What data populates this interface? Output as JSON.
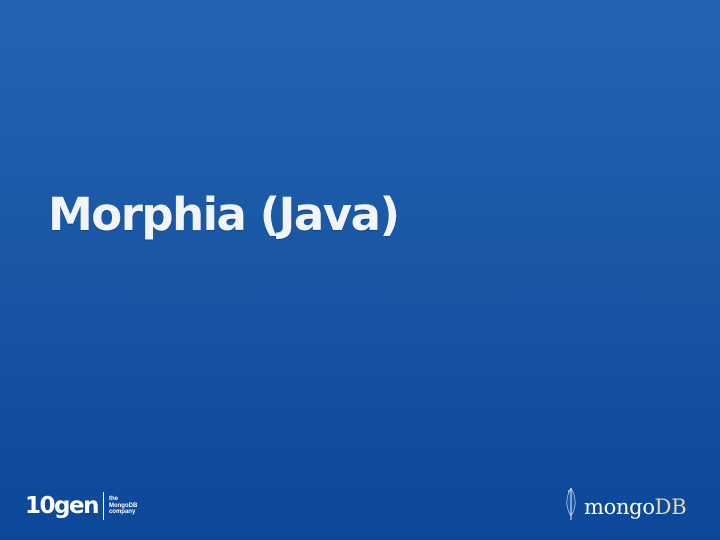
{
  "slide": {
    "title": "Morphia (Java)"
  },
  "footer": {
    "left_logo": {
      "wordmark": "10gen",
      "tagline_line1": "the",
      "tagline_line2": "MongoDB",
      "tagline_line3": "company"
    },
    "right_logo": {
      "wordmark_part1": "mongo",
      "wordmark_part2": "DB",
      "icon": "leaf-icon"
    }
  },
  "colors": {
    "background_top": "#2264b3",
    "background_bottom": "#0c479a",
    "title_text": "#f1f4f8",
    "db_accent": "#e6d9a8"
  }
}
